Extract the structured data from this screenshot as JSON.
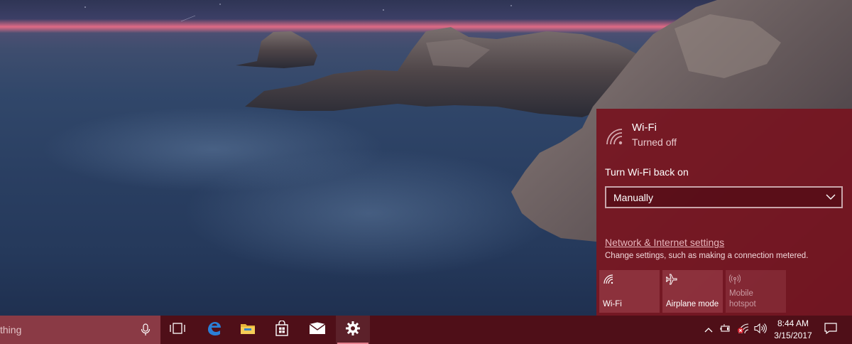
{
  "wifi_flyout": {
    "network_name": "Wi-Fi",
    "status": "Turned off",
    "turn_back_on_label": "Turn Wi-Fi back on",
    "turn_back_on_value": "Manually",
    "settings_link": "Network & Internet settings",
    "settings_description": "Change settings, such as making a connection metered.",
    "quick_actions": [
      {
        "label": "Wi-Fi",
        "icon": "wifi-icon",
        "enabled": true
      },
      {
        "label": "Airplane mode",
        "icon": "airplane-icon",
        "enabled": true
      },
      {
        "label": "Mobile hotspot",
        "icon": "hotspot-icon",
        "enabled": false
      }
    ]
  },
  "taskbar": {
    "search_text": "thing",
    "pinned_apps": [
      {
        "name": "Task View",
        "icon": "task-view-icon"
      },
      {
        "name": "Microsoft Edge",
        "icon": "edge-icon"
      },
      {
        "name": "File Explorer",
        "icon": "folder-icon"
      },
      {
        "name": "Store",
        "icon": "store-icon"
      },
      {
        "name": "Mail",
        "icon": "mail-icon"
      },
      {
        "name": "Settings",
        "icon": "gear-icon",
        "active": true
      }
    ],
    "clock": {
      "time": "8:44 AM",
      "date": "3/15/2017"
    }
  },
  "colors": {
    "flyout_accent": "#761420",
    "taskbar": "#4f0f18",
    "edge_blue": "#2b7fd6"
  }
}
